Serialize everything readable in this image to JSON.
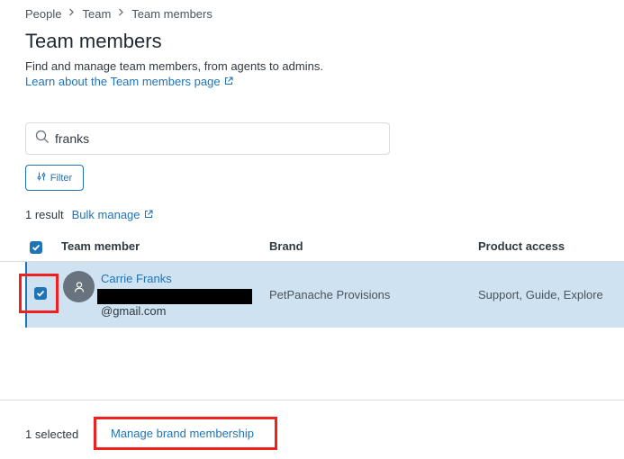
{
  "breadcrumb": [
    "People",
    "Team",
    "Team members"
  ],
  "page": {
    "title": "Team members",
    "description": "Find and manage team members, from agents to admins.",
    "learn_link": "Learn about the Team members page"
  },
  "search": {
    "value": "franks",
    "placeholder": ""
  },
  "filter_label": "Filter",
  "results": {
    "count_text": "1 result",
    "bulk_manage": "Bulk manage"
  },
  "table": {
    "columns": [
      "Team member",
      "Brand",
      "Product access"
    ],
    "rows": [
      {
        "name": "Carrie Franks",
        "email": "@gmail.com",
        "brand": "PetPanache Provisions",
        "access": "Support, Guide, Explore",
        "selected": true
      }
    ]
  },
  "footer": {
    "selected_text": "1 selected",
    "manage_brand": "Manage brand membership"
  },
  "colors": {
    "accent": "#1f73b7",
    "row_selected": "#cee2f2",
    "highlight": "#ef2020"
  },
  "icons": [
    "chevron-right-icon",
    "external-link-icon",
    "search-icon",
    "filter-icon",
    "checkmark-icon",
    "user-icon"
  ]
}
